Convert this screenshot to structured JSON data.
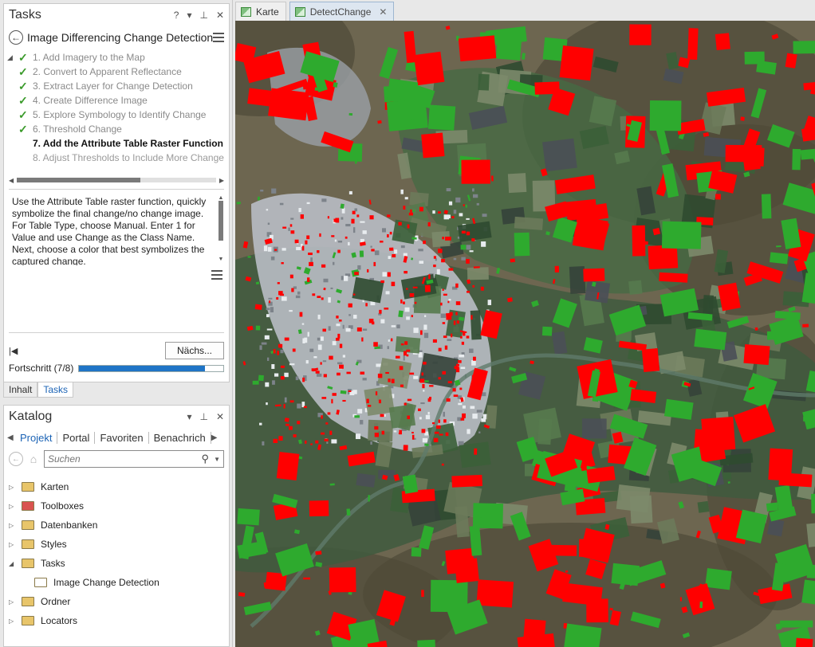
{
  "tasks_pane": {
    "title": "Tasks",
    "controls": {
      "help": "?",
      "dropdown": "▾",
      "pin": "⊥",
      "close": "✕"
    },
    "task_title": "Image Differencing Change Detection",
    "steps": [
      {
        "label": "1.  Add Imagery to the Map",
        "state": "done"
      },
      {
        "label": "2.  Convert to Apparent Reflectance",
        "state": "done"
      },
      {
        "label": "3.  Extract Layer for Change Detection",
        "state": "done"
      },
      {
        "label": "4.  Create Difference Image",
        "state": "done"
      },
      {
        "label": "5.  Explore Symbology to Identify Change",
        "state": "done"
      },
      {
        "label": "6.  Threshold Change",
        "state": "done"
      },
      {
        "label": "7.  Add the Attribute Table Raster Function",
        "state": "active"
      },
      {
        "label": "8.  Adjust Thresholds to Include More Change",
        "state": "pending"
      }
    ],
    "instructions": "Use the Attribute Table raster function, quickly symbolize the final change/no change image. For Table Type, choose Manual. Enter 1 for Value and use Change as the Class Name. Next, choose a color that best symbolizes the captured change.",
    "next_label": "Nächs...",
    "progress_label": "Fortschritt (7/8)",
    "progress_fraction": 0.875,
    "bottom_tabs": [
      "Inhalt",
      "Tasks"
    ],
    "selected_bottom_tab": "Tasks"
  },
  "catalog_pane": {
    "title": "Katalog",
    "controls": {
      "dropdown": "▾",
      "pin": "⊥",
      "close": "✕"
    },
    "tabs": [
      "Projekt",
      "Portal",
      "Favoriten",
      "Benachrich"
    ],
    "selected_tab": "Projekt",
    "search_placeholder": "Suchen",
    "items": [
      {
        "label": "Karten",
        "expander": "▷",
        "icon": "maps-folder-icon",
        "color": "#e8c56a",
        "level": 0
      },
      {
        "label": "Toolboxes",
        "expander": "▷",
        "icon": "toolbox-folder-icon",
        "color": "#d9534f",
        "level": 0
      },
      {
        "label": "Datenbanken",
        "expander": "▷",
        "icon": "database-folder-icon",
        "color": "#e8c56a",
        "level": 0
      },
      {
        "label": "Styles",
        "expander": "▷",
        "icon": "styles-folder-icon",
        "color": "#e8c56a",
        "level": 0
      },
      {
        "label": "Tasks",
        "expander": "◢",
        "icon": "tasks-folder-icon",
        "color": "#e8c56a",
        "level": 0
      },
      {
        "label": "Image Change Detection",
        "expander": "",
        "icon": "task-file-icon",
        "color": "#ffffff",
        "level": 1
      },
      {
        "label": "Ordner",
        "expander": "▷",
        "icon": "folder-icon",
        "color": "#e8c56a",
        "level": 0
      },
      {
        "label": "Locators",
        "expander": "▷",
        "icon": "locators-folder-icon",
        "color": "#e8c56a",
        "level": 0
      }
    ]
  },
  "doc_tabs": [
    {
      "label": "Karte",
      "selected": false,
      "closable": false
    },
    {
      "label": "DetectChange",
      "selected": true,
      "closable": true
    }
  ],
  "map": {
    "change_color": "#ff0000",
    "no_change_color": "#2eaa2e",
    "urban_color": "#b8bcc4",
    "terrain_color": "#6d6650"
  }
}
